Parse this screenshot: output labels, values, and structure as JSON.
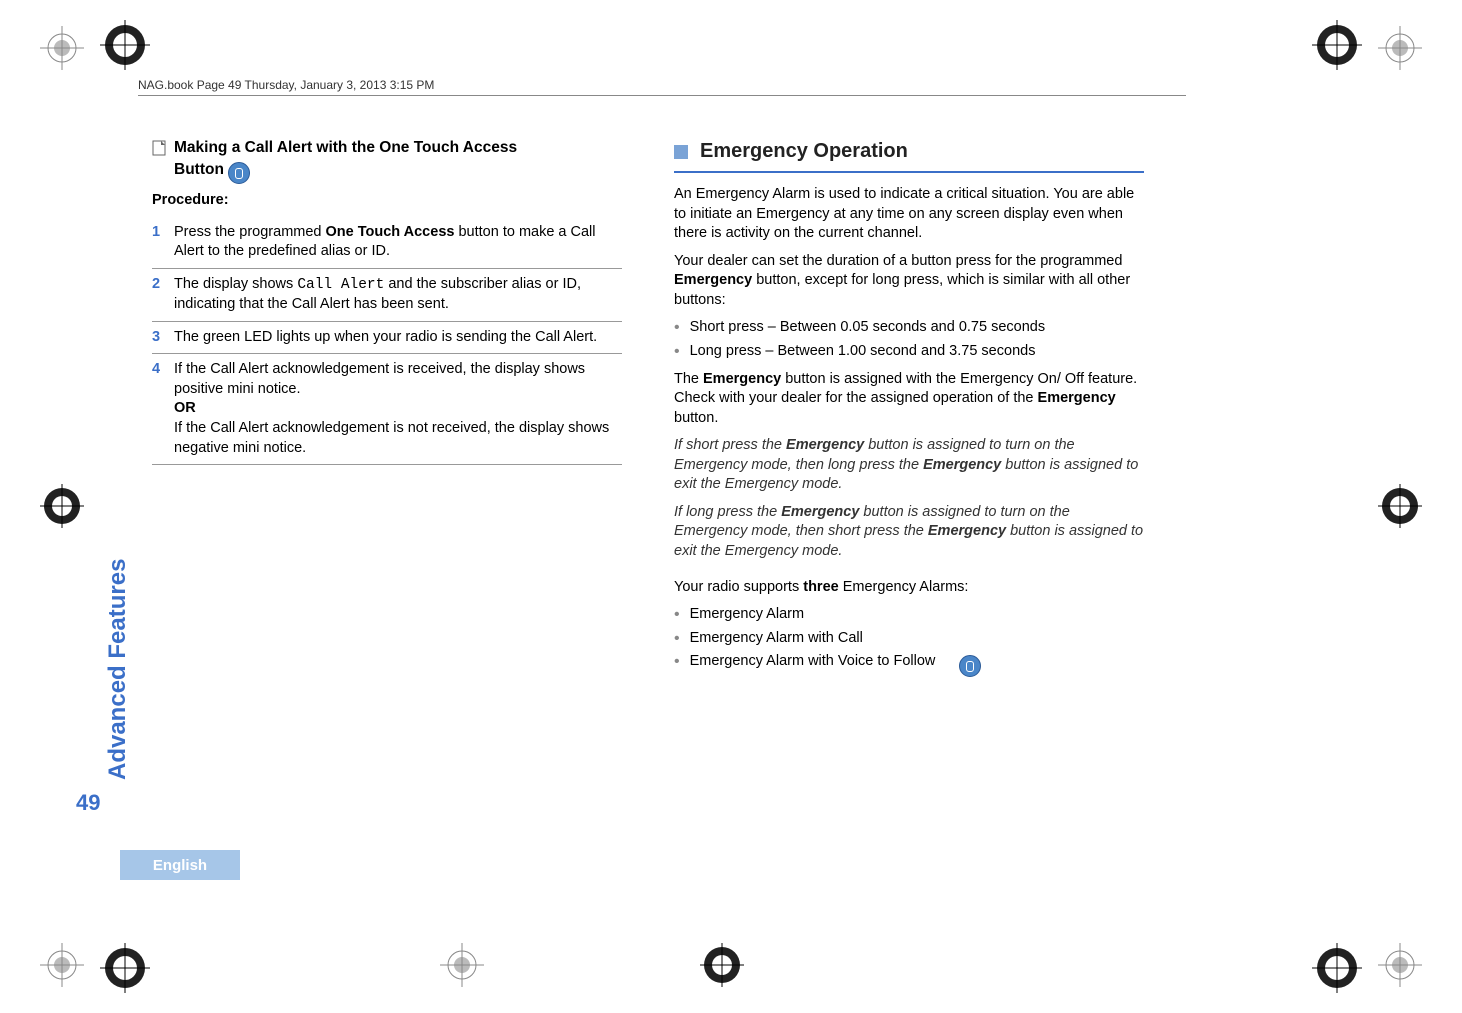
{
  "header": {
    "running_head": "NAG.book  Page 49  Thursday, January 3, 2013  3:15 PM"
  },
  "side": {
    "section_label": "Advanced Features",
    "page_number": "49",
    "language": "English"
  },
  "left": {
    "title_prefix": "Making a Call Alert with the One Touch Access",
    "title_suffix": "Button",
    "procedure_label": "Procedure:",
    "steps": {
      "s1": {
        "num": "1",
        "a": "Press the programmed ",
        "b": "One Touch Access",
        "c": " button to make a Call Alert to the predefined alias or ID."
      },
      "s2": {
        "num": "2",
        "a": "The display shows ",
        "code": "Call Alert",
        "b": " and the subscriber alias or ID, indicating that the Call Alert has been sent."
      },
      "s3": {
        "num": "3",
        "text": "The green LED lights up when your radio is sending the Call Alert."
      },
      "s4": {
        "num": "4",
        "a": "If the Call Alert acknowledgement is received, the display shows positive mini notice.",
        "or": "OR",
        "b": "If the Call Alert acknowledgement is not received, the display shows negative mini notice."
      }
    }
  },
  "right": {
    "heading": "Emergency Operation",
    "p1": "An Emergency Alarm is used to indicate a critical situation. You are able to initiate an Emergency at any time on any screen display even when there is activity on the current channel.",
    "p2a": "Your dealer can set the duration of a button press for the programmed ",
    "p2b": "Emergency",
    "p2c": " button, except for long press, which is similar with all other buttons:",
    "b1": "Short press – Between 0.05 seconds and 0.75 seconds",
    "b2": "Long press – Between 1.00 second and 3.75 seconds",
    "p3a": "The ",
    "p3b": "Emergency",
    "p3c": " button is assigned with the Emergency On/ Off feature. Check with your dealer for the assigned operation of the ",
    "p3d": "Emergency",
    "p3e": " button.",
    "it1a": "If short press the ",
    "it1b": "Emergency",
    "it1c": " button is assigned to turn on the Emergency mode, then long press the ",
    "it1d": "Emergency",
    "it1e": " button is assigned to exit the Emergency mode.",
    "it2a": "If long press the ",
    "it2b": "Emergency",
    "it2c": " button is assigned to turn on the Emergency mode, then short press the ",
    "it2d": "Emergency",
    "it2e": " button is assigned to exit the Emergency mode.",
    "p4a": "Your radio supports ",
    "p4b": "three",
    "p4c": " Emergency Alarms:",
    "list": {
      "l1": "Emergency Alarm",
      "l2": "Emergency Alarm with Call",
      "l3": "Emergency Alarm with Voice to Follow"
    }
  }
}
